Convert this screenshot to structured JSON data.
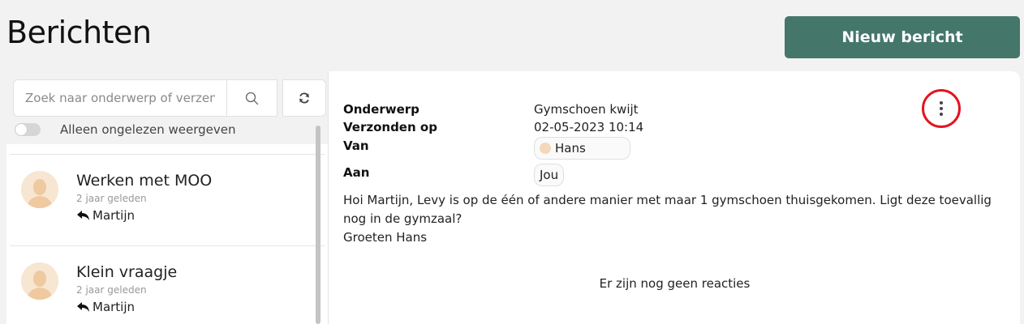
{
  "page": {
    "title": "Berichten"
  },
  "toolbar": {
    "new_message_label": "Nieuw bericht"
  },
  "search": {
    "placeholder": "Zoek naar onderwerp of verzender",
    "value": ""
  },
  "filter": {
    "unread_only_label": "Alleen ongelezen weergeven",
    "unread_only_checked": false
  },
  "messages": [
    {
      "title": "Werken met MOO",
      "time": "2 jaar geleden",
      "author": "Martijn"
    },
    {
      "title": "Klein vraagje",
      "time": "2 jaar geleden",
      "author": "Martijn"
    }
  ],
  "detail": {
    "subject_label": "Onderwerp",
    "subject": "Gymschoen kwijt",
    "sent_label": "Verzonden op",
    "sent": "02-05-2023 10:14",
    "from_label": "Van",
    "from": "Hans",
    "to_label": "Aan",
    "to": "Jou",
    "body_line1": "Hoi Martijn, Levy is op de één of andere manier met maar 1 gymschoen thuisgekomen. Ligt deze toevallig",
    "body_line2": "nog in de gymzaal?",
    "body_line3": "Groeten Hans",
    "no_reactions": "Er zijn nog geen reacties"
  },
  "colors": {
    "accent": "#44776a",
    "highlight_ring": "#e3141f",
    "background": "#f2f2f2"
  },
  "icons": {
    "search": "search-icon",
    "refresh": "refresh-icon",
    "reply": "reply-icon",
    "more": "more-vertical-icon",
    "avatar": "user-avatar-icon"
  }
}
